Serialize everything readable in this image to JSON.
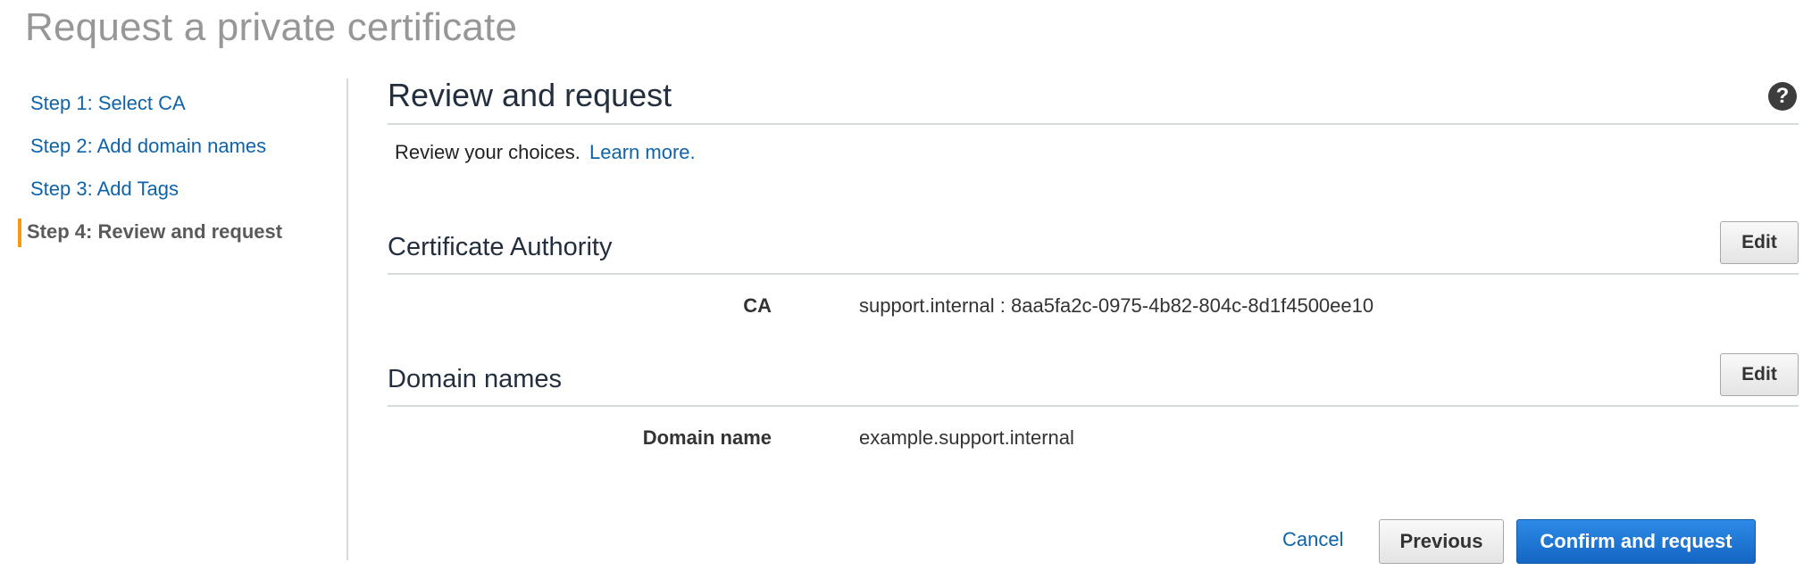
{
  "page": {
    "title": "Request a private certificate"
  },
  "steps": [
    {
      "label": "Step 1: Select CA",
      "active": false
    },
    {
      "label": "Step 2: Add domain names",
      "active": false
    },
    {
      "label": "Step 3: Add Tags",
      "active": false
    },
    {
      "label": "Step 4: Review and request",
      "active": true
    }
  ],
  "main": {
    "title": "Review and request",
    "help_icon": "question-circle-icon",
    "intro_text": "Review your choices.",
    "learn_more": "Learn more."
  },
  "ca_section": {
    "title": "Certificate Authority",
    "edit_label": "Edit",
    "fields": [
      {
        "label": "CA",
        "value": "support.internal : 8aa5fa2c-0975-4b82-804c-8d1f4500ee10"
      }
    ]
  },
  "domain_section": {
    "title": "Domain names",
    "edit_label": "Edit",
    "fields": [
      {
        "label": "Domain name",
        "value": "example.support.internal"
      }
    ]
  },
  "actions": {
    "cancel": "Cancel",
    "previous": "Previous",
    "confirm": "Confirm and request"
  },
  "colors": {
    "link": "#0f63a8",
    "active_step_marker": "#f39c12",
    "primary_button": "#1466c3",
    "title_gray": "#979797"
  }
}
